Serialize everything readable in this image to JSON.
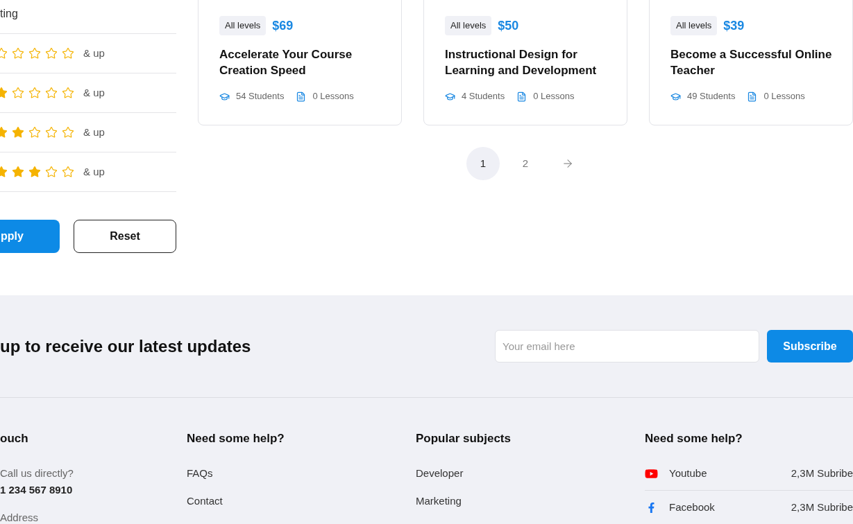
{
  "filter_sidebar": {
    "heading": "ting",
    "rating_options": [
      {
        "stars": 0,
        "label": "& up"
      },
      {
        "stars": 1,
        "label": "& up"
      },
      {
        "stars": 2,
        "label": "& up"
      },
      {
        "stars": 3,
        "label": "& up"
      }
    ],
    "buttons": [
      {
        "kind": "primary",
        "label": "pply"
      },
      {
        "kind": "outline",
        "label": "Reset"
      }
    ]
  },
  "courses": [
    {
      "level": "All levels",
      "price": "$69",
      "title": "Accelerate Your Course Creation Speed",
      "students": "54 Students",
      "lessons": "0 Lessons"
    },
    {
      "level": "All levels",
      "price": "$50",
      "title": "Instructional Design for Learning and Development",
      "students": "4 Students",
      "lessons": "0 Lessons"
    },
    {
      "level": "All levels",
      "price": "$39",
      "title": "Become a Successful Online Teacher",
      "students": "49 Students",
      "lessons": "0 Lessons"
    }
  ],
  "pagination": {
    "pages": [
      {
        "label": "1",
        "selected": true
      },
      {
        "label": "2",
        "selected": false
      }
    ]
  },
  "newsletter": {
    "heading": "up to receive our latest updates",
    "email_field": {
      "placeholder": "Your email here"
    },
    "button": "Subscribe"
  },
  "footer": {
    "columns": [
      {
        "kind": "contact",
        "heading": "ouch",
        "items": [
          {
            "label": "Call us directly?",
            "value": "1 234 567 8910"
          },
          {
            "label": "Address"
          }
        ]
      },
      {
        "kind": "links",
        "heading": "Need some help?",
        "items": [
          {
            "label": "FAQs"
          },
          {
            "label": "Contact"
          }
        ]
      },
      {
        "kind": "links",
        "heading": "Popular subjects",
        "items": [
          {
            "label": "Developer"
          },
          {
            "label": "Marketing"
          }
        ]
      },
      {
        "kind": "social",
        "heading": "Need some help?",
        "items": [
          {
            "kind": "youtube",
            "label": "Youtube",
            "value": "2,3M Subribe"
          },
          {
            "kind": "facebook",
            "label": "Facebook",
            "value": "2,3M Subribe"
          }
        ]
      }
    ]
  }
}
